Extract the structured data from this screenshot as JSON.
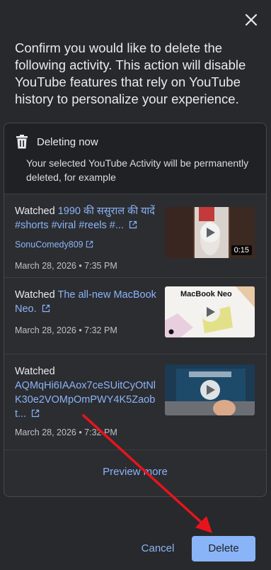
{
  "dialog": {
    "intro": "Confirm you would like to delete the following activity. This action will disable YouTube features that rely on YouTube history to personalize your experience.",
    "close_icon": "close-icon"
  },
  "card": {
    "head_title": "Deleting now",
    "head_desc": "Your selected YouTube Activity will be permanently deleted, for example",
    "items": [
      {
        "prefix": "Watched",
        "title": "1990 की ससुराल की यादें #shorts #viral #reels #...",
        "channel": "SonuComedy809",
        "date": "March 28, 2026 • 7:35 PM",
        "duration": "0:15"
      },
      {
        "prefix": "Watched",
        "title": "The all-new MacBook Neo.",
        "channel": "",
        "date": "March 28, 2026 • 7:32 PM",
        "thumb_text": "MacBook Neo"
      },
      {
        "prefix": "Watched",
        "title": "AQMqHi6IAAox7ceSUitCyOtNlK30e2VOMpOmPWY4K5Zaobt...",
        "channel": "",
        "date": "March 28, 2026 • 7:32 PM"
      }
    ],
    "preview_more": "Preview more"
  },
  "footer": {
    "cancel_label": "Cancel",
    "delete_label": "Delete"
  },
  "colors": {
    "background": "#28292c",
    "link": "#8ab4f8",
    "annotation_arrow": "#e8141c"
  }
}
